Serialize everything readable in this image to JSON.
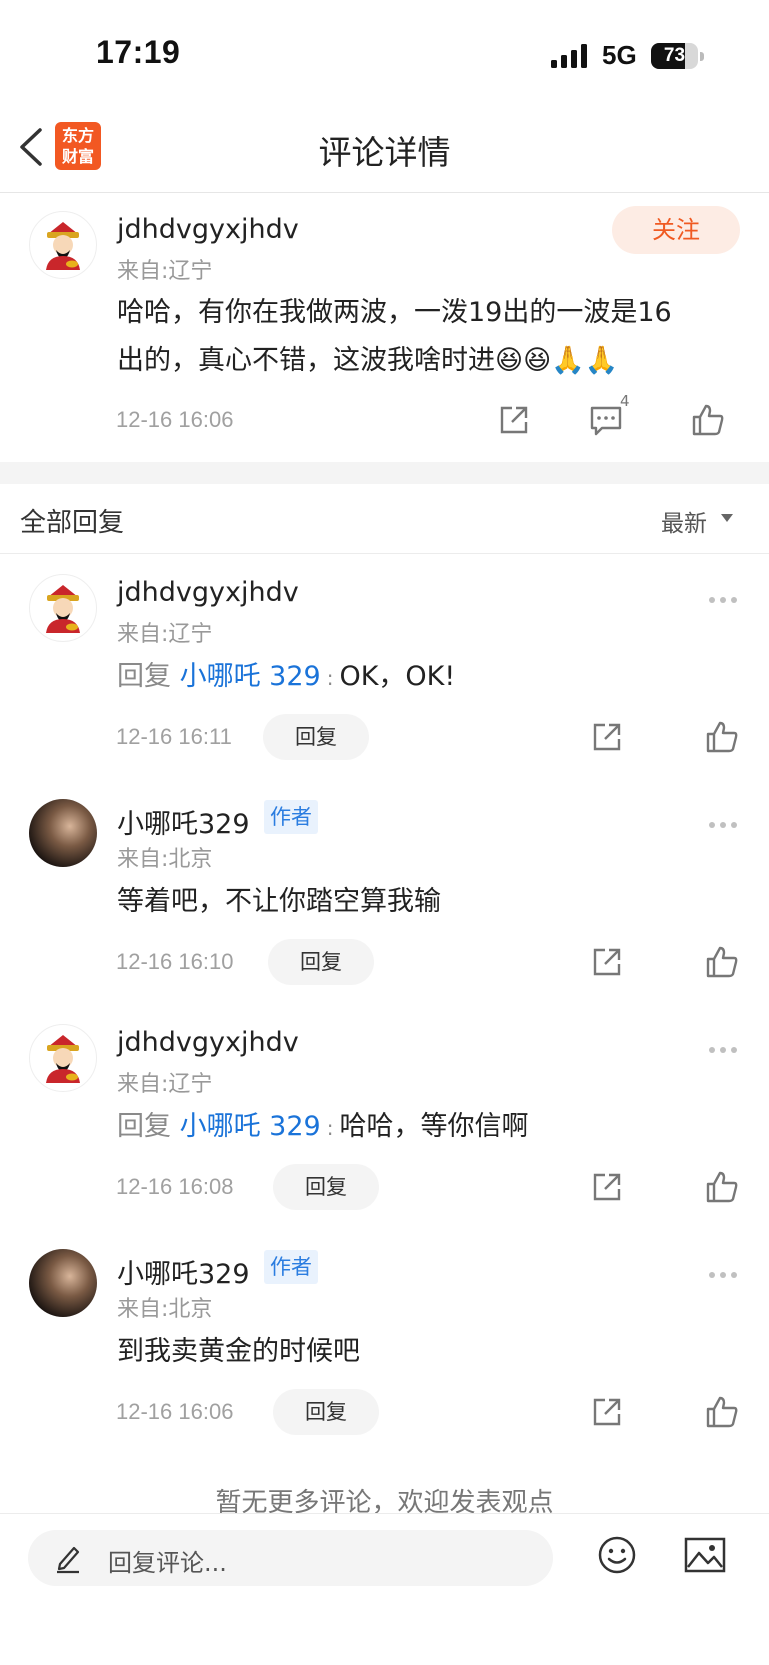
{
  "status_bar": {
    "time": "17:19",
    "network": "5G",
    "battery": "73",
    "battery_level": 0.73
  },
  "nav": {
    "title": "评论详情",
    "logo_line1": "东方",
    "logo_line2": "财富"
  },
  "main_comment": {
    "username": "jdhdvgyxjhdv",
    "location": "来自:辽宁",
    "follow_label": "关注",
    "text_line1": "哈哈，有你在我做两波，一泼19出的一波是16",
    "text_line2": "出的，真心不错，这波我啥时进😆😆🙏🙏",
    "time": "12-16 16:06",
    "comment_count": "4",
    "icons": {
      "share": "share-icon",
      "comment": "comment-icon",
      "like": "thumbs-up-icon"
    }
  },
  "section": {
    "title": "全部回复",
    "sort_label": "最新"
  },
  "replies": [
    {
      "username": "jdhdvgyxjhdv",
      "location": "来自:辽宁",
      "is_author": false,
      "reply_prefix": "回复",
      "reply_to": "小哪吒 329",
      "colon": ":",
      "text": "OK，OK!",
      "time": "12-16 16:11",
      "reply_label": "回复"
    },
    {
      "username": "小哪吒329",
      "location": "来自:北京",
      "is_author": true,
      "author_tag": "作者",
      "text": "等着吧，不让你踏空算我输",
      "time": "12-16 16:10",
      "reply_label": "回复"
    },
    {
      "username": "jdhdvgyxjhdv",
      "location": "来自:辽宁",
      "is_author": false,
      "reply_prefix": "回复",
      "reply_to": "小哪吒 329",
      "colon": ":",
      "text": "哈哈，等你信啊",
      "time": "12-16 16:08",
      "reply_label": "回复"
    },
    {
      "username": "小哪吒329",
      "location": "来自:北京",
      "is_author": true,
      "author_tag": "作者",
      "text": "到我卖黄金的时候吧",
      "time": "12-16 16:06",
      "reply_label": "回复"
    }
  ],
  "footer": {
    "note": "暂无更多评论，欢迎发表观点",
    "input_placeholder": "回复评论..."
  },
  "colors": {
    "brand": "#f25822",
    "follow_bg": "#fdece4",
    "link_blue": "#1a73d9"
  }
}
